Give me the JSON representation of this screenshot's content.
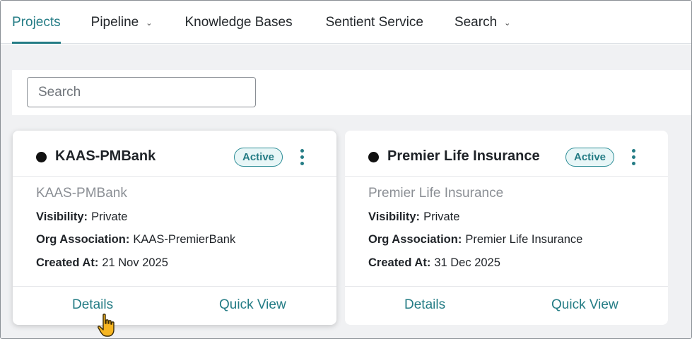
{
  "nav": {
    "items": [
      {
        "label": "Projects",
        "dropdown": false,
        "active": true
      },
      {
        "label": "Pipeline",
        "dropdown": true,
        "active": false
      },
      {
        "label": "Knowledge Bases",
        "dropdown": false,
        "active": false
      },
      {
        "label": "Sentient Service",
        "dropdown": false,
        "active": false
      },
      {
        "label": "Search",
        "dropdown": true,
        "active": false
      }
    ]
  },
  "search": {
    "placeholder": "Search",
    "value": ""
  },
  "projects": [
    {
      "title": "KAAS-PMBank",
      "status": "Active",
      "subtitle": "KAAS-PMBank",
      "visibility_label": "Visibility:",
      "visibility": "Private",
      "org_label": "Org Association:",
      "org": "KAAS-PremierBank",
      "created_label": "Created At:",
      "created": "21 Nov 2025",
      "details_label": "Details",
      "quickview_label": "Quick View"
    },
    {
      "title": "Premier Life Insurance",
      "status": "Active",
      "subtitle": "Premier Life Insurance",
      "visibility_label": "Visibility:",
      "visibility": "Private",
      "org_label": "Org Association:",
      "org": "Premier Life Insurance",
      "created_label": "Created At:",
      "created": "31 Dec 2025",
      "details_label": "Details",
      "quickview_label": "Quick View"
    }
  ],
  "icons": {
    "nav_dropdown": "chevron-down-icon",
    "card_menu": "kebab-menu-icon",
    "status_dot": "status-dot-icon",
    "pointer": "hand-pointer-icon"
  },
  "colors": {
    "accent": "#247c85",
    "badge_bg": "#e8f6f7",
    "page_bg": "#f0f1f3",
    "muted_text": "#8b8f95"
  }
}
